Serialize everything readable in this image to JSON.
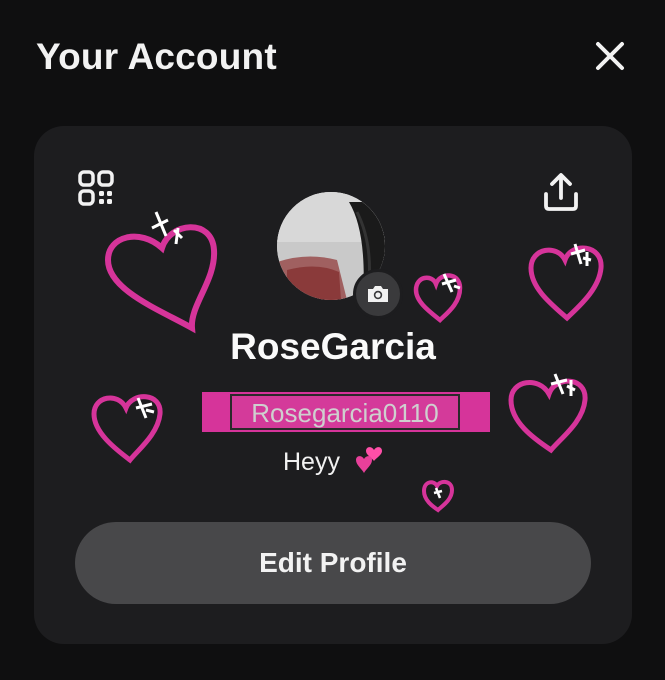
{
  "header": {
    "title": "Your Account",
    "close_icon": "close-icon"
  },
  "card": {
    "qr_icon": "qr-code-icon",
    "share_icon": "share-upload-icon",
    "camera_icon": "camera-icon",
    "display_name": "RoseGarcia",
    "handle": "Rosegarcia0110",
    "bio": "Heyy",
    "bio_emoji": "two-hearts-emoji",
    "edit_button_label": "Edit Profile"
  },
  "colors": {
    "background": "#0f0f10",
    "card": "#1d1d1f",
    "button": "#48484a",
    "doodle_pink": "#d6349a"
  }
}
